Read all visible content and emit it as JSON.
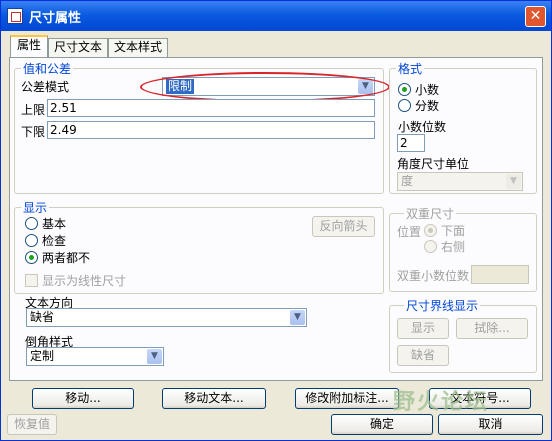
{
  "window": {
    "title": "尺寸属性",
    "close_glyph": "✕"
  },
  "tabs": [
    {
      "label": "属性",
      "active": true
    },
    {
      "label": "尺寸文本",
      "active": false
    },
    {
      "label": "文本样式",
      "active": false
    }
  ],
  "value_tolerance": {
    "legend": "值和公差",
    "tolerance_mode_label": "公差模式",
    "tolerance_mode_value": "限制",
    "upper_label": "上限",
    "upper_value": "2.51",
    "lower_label": "下限",
    "lower_value": "2.49"
  },
  "format": {
    "legend": "格式",
    "decimal_label": "小数",
    "fraction_label": "分数",
    "selected": "小数",
    "decimal_places_label": "小数位数",
    "decimal_places_value": "2",
    "angular_unit_label": "角度尺寸单位",
    "angular_unit_value": "度"
  },
  "display": {
    "legend": "显示",
    "options": [
      "基本",
      "检查",
      "两者都不"
    ],
    "selected": "两者都不",
    "flip_arrows_button": "反向箭头",
    "linear_display_label": "显示为线性尺寸"
  },
  "text_direction": {
    "label": "文本方向",
    "value": "缺省"
  },
  "chamfer_style": {
    "label": "倒角样式",
    "value": "定制"
  },
  "dual_dimension": {
    "legend": "双重尺寸",
    "position_label": "位置",
    "below_label": "下面",
    "right_label": "右侧",
    "dual_decimal_label": "双重小数位数"
  },
  "witness_display": {
    "legend": "尺寸界线显示",
    "show_button": "显示",
    "erase_button": "拭除...",
    "default_button": "缺省"
  },
  "bottom_buttons": {
    "move": "移动...",
    "move_text": "移动文本...",
    "modify_attached": "修改附加标注...",
    "text_symbol": "文本符号...",
    "restore": "恢复值",
    "ok": "确定",
    "cancel": "取消"
  },
  "watermark": {
    "text": "野火论坛"
  },
  "colors": {
    "title_bar": "#0a5be0",
    "group_legend": "#0046d5",
    "highlight_ellipse": "#d8262a",
    "selection": "#316ac5"
  }
}
